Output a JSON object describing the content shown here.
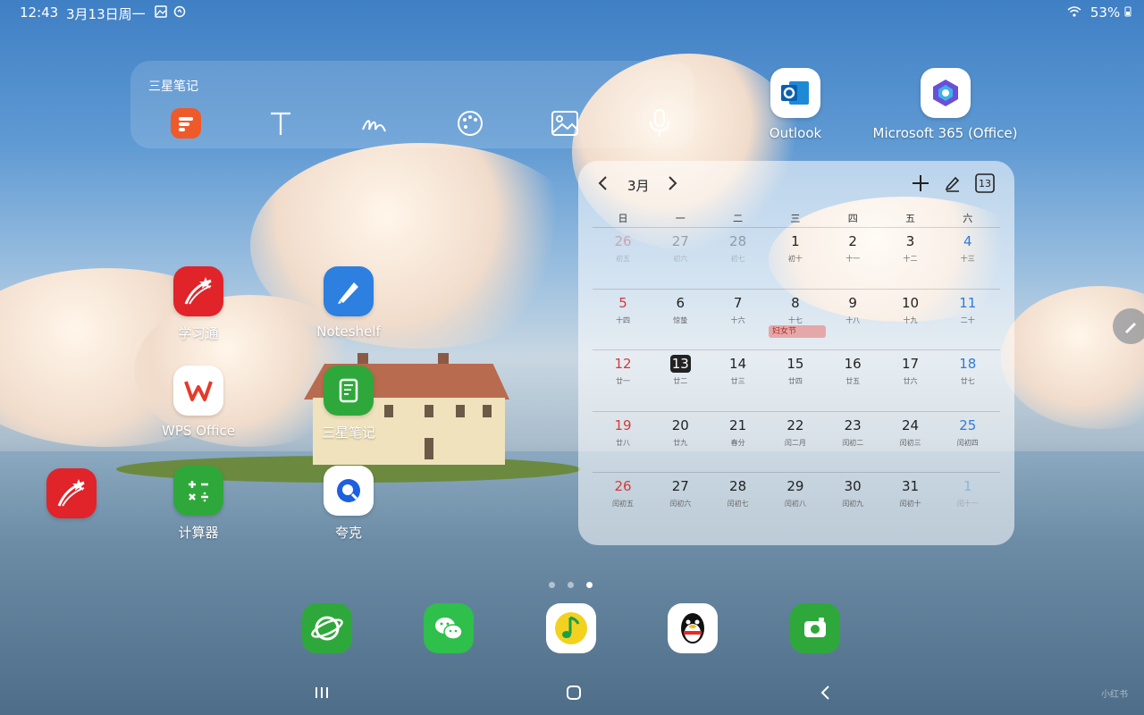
{
  "status_bar": {
    "time": "12:43",
    "date": "3月13日周一",
    "battery": "53%"
  },
  "notes_widget": {
    "title": "三星笔记",
    "tools": [
      "new-note-icon",
      "text-icon",
      "handwriting-icon",
      "palette-icon",
      "image-icon",
      "mic-icon"
    ]
  },
  "apps": {
    "outlook": "Outlook",
    "m365": "Microsoft 365 (Office)",
    "xuexitong": "学习通",
    "noteshelf": "Noteshelf",
    "wps": "WPS Office",
    "samsung_notes": "三星笔记",
    "calculator": "计算器",
    "quark": "夸克"
  },
  "calendar": {
    "month": "3月",
    "today_badge": "13",
    "weekdays": [
      "日",
      "一",
      "二",
      "三",
      "四",
      "五",
      "六"
    ],
    "weeks": [
      [
        {
          "d": "26",
          "l": "初五",
          "faded": true
        },
        {
          "d": "27",
          "l": "初六",
          "faded": true
        },
        {
          "d": "28",
          "l": "初七",
          "faded": true
        },
        {
          "d": "1",
          "l": "初十"
        },
        {
          "d": "2",
          "l": "十一"
        },
        {
          "d": "3",
          "l": "十二"
        },
        {
          "d": "4",
          "l": "十三"
        }
      ],
      [
        {
          "d": "5",
          "l": "十四"
        },
        {
          "d": "6",
          "l": "惊蛰"
        },
        {
          "d": "7",
          "l": "十六"
        },
        {
          "d": "8",
          "l": "十七"
        },
        {
          "d": "9",
          "l": "十八"
        },
        {
          "d": "10",
          "l": "十九"
        },
        {
          "d": "11",
          "l": "二十"
        }
      ],
      [
        {
          "d": "12",
          "l": "廿一"
        },
        {
          "d": "13",
          "l": "廿二",
          "today": true
        },
        {
          "d": "14",
          "l": "廿三"
        },
        {
          "d": "15",
          "l": "廿四"
        },
        {
          "d": "16",
          "l": "廿五"
        },
        {
          "d": "17",
          "l": "廿六"
        },
        {
          "d": "18",
          "l": "廿七"
        }
      ],
      [
        {
          "d": "19",
          "l": "廿八"
        },
        {
          "d": "20",
          "l": "廿九"
        },
        {
          "d": "21",
          "l": "春分"
        },
        {
          "d": "22",
          "l": "闰二月"
        },
        {
          "d": "23",
          "l": "闰初二"
        },
        {
          "d": "24",
          "l": "闰初三"
        },
        {
          "d": "25",
          "l": "闰初四"
        }
      ],
      [
        {
          "d": "26",
          "l": "闰初五"
        },
        {
          "d": "27",
          "l": "闰初六"
        },
        {
          "d": "28",
          "l": "闰初七"
        },
        {
          "d": "29",
          "l": "闰初八"
        },
        {
          "d": "30",
          "l": "闰初九"
        },
        {
          "d": "31",
          "l": "闰初十"
        },
        {
          "d": "1",
          "l": "闰十一",
          "faded": true
        }
      ]
    ],
    "event_label": "妇女节"
  },
  "dock": [
    "browser-icon",
    "wechat-icon",
    "qq-music-icon",
    "qq-icon",
    "camera-icon"
  ],
  "watermark": "小红书"
}
